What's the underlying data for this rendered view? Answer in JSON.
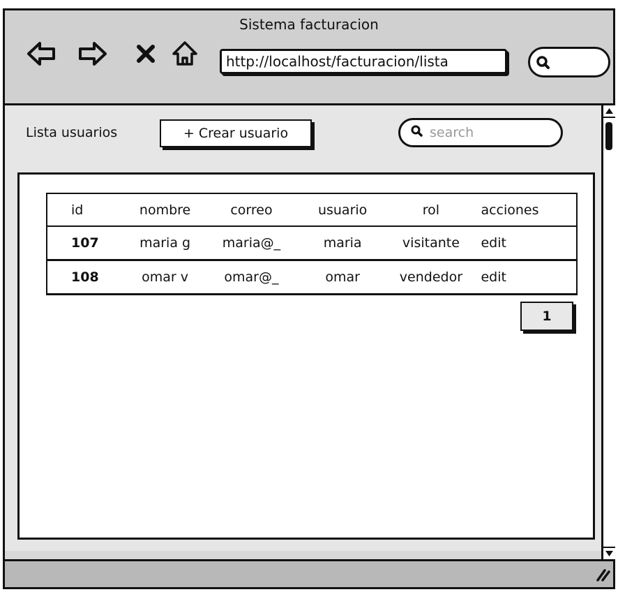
{
  "window": {
    "title": "Sistema facturacion"
  },
  "browser": {
    "url": "http://localhost/facturacion/lista",
    "nav_icons": [
      "back-arrow-icon",
      "forward-arrow-icon",
      "close-icon",
      "home-icon"
    ]
  },
  "toolbar": {
    "title": "Lista usuarios",
    "create_label": "+ Crear usuario",
    "search_placeholder": "search"
  },
  "table": {
    "headers": [
      "id",
      "nombre",
      "correo",
      "usuario",
      "rol",
      "acciones"
    ],
    "rows": [
      {
        "id": "107",
        "nombre": "maria g",
        "correo": "maria@_",
        "usuario": "maria",
        "rol": "visitante",
        "acciones": "edit"
      },
      {
        "id": "108",
        "nombre": "omar v",
        "correo": "omar@_",
        "usuario": "omar",
        "rol": "vendedor",
        "acciones": "edit"
      }
    ]
  },
  "pagination": {
    "current_page": "1"
  }
}
